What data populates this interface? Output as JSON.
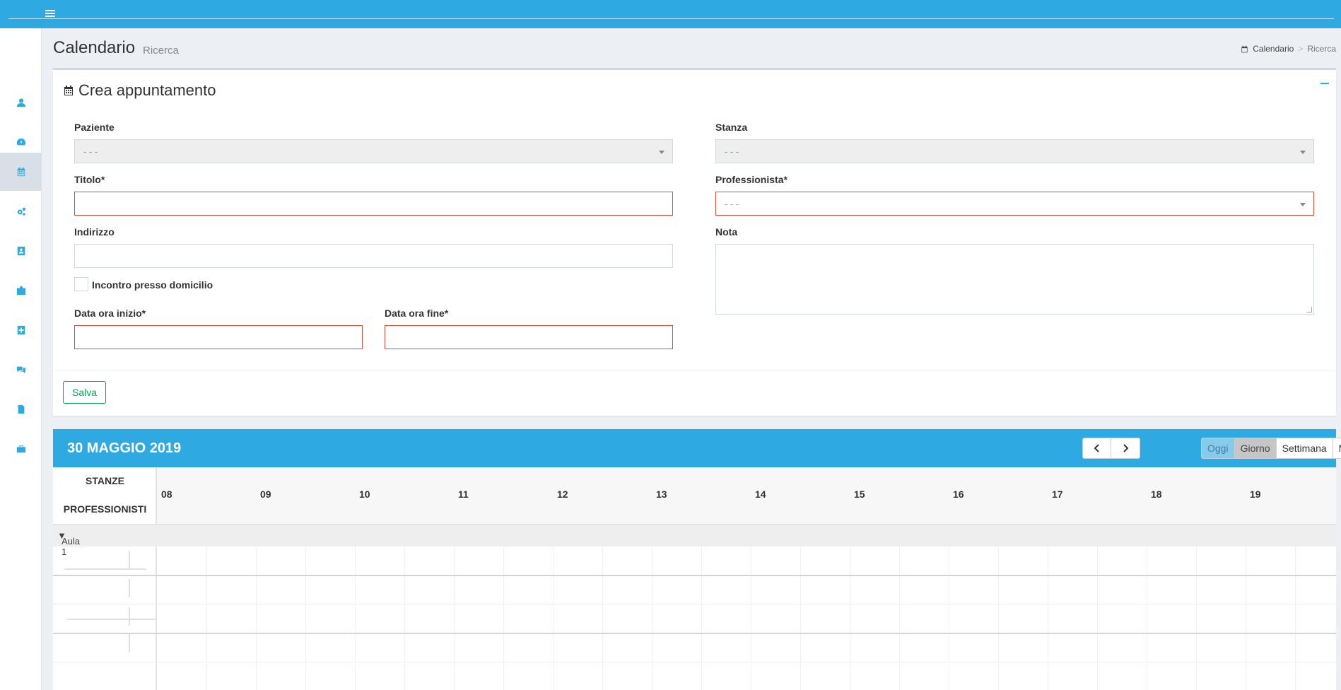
{
  "header": {
    "page_title": "Calendario",
    "page_subtitle": "Ricerca",
    "breadcrumb": [
      "Calendario",
      "Ricerca"
    ]
  },
  "sidebar": {
    "items": [
      {
        "icon": "user-icon"
      },
      {
        "icon": "dashboard-icon"
      },
      {
        "icon": "calendar-icon",
        "active": true
      },
      {
        "icon": "cogs-icon"
      },
      {
        "icon": "contact-card-icon"
      },
      {
        "icon": "id-badge-icon"
      },
      {
        "icon": "medical-record-icon"
      },
      {
        "icon": "comments-icon"
      },
      {
        "icon": "document-icon"
      },
      {
        "icon": "briefcase-icon"
      }
    ]
  },
  "form": {
    "title": "Crea appuntamento",
    "paziente_label": "Paziente",
    "paziente_value": "- - -",
    "stanza_label": "Stanza",
    "stanza_value": "- - -",
    "titolo_label": "Titolo*",
    "professionista_label": "Professionista*",
    "professionista_value": "- - -",
    "indirizzo_label": "Indirizzo",
    "nota_label": "Nota",
    "domicilio_label": "Incontro presso domicilio",
    "inizio_label": "Data ora inizio*",
    "fine_label": "Data ora fine*",
    "save_label": "Salva"
  },
  "calendar": {
    "date_title": "30 MAGGIO 2019",
    "views": [
      "Oggi",
      "Giorno",
      "Settimana",
      "Mese"
    ],
    "active_view": "Giorno",
    "resource_header_1": "STANZE",
    "resource_header_2": "PROFESSIONISTI",
    "hours": [
      "08",
      "09",
      "10",
      "11",
      "12",
      "13",
      "14",
      "15",
      "16",
      "17",
      "18",
      "19"
    ],
    "group": "Aula 1"
  },
  "colors": {
    "primary": "#2ea9e2",
    "error": "#dd4b39",
    "success": "#00a65a"
  }
}
